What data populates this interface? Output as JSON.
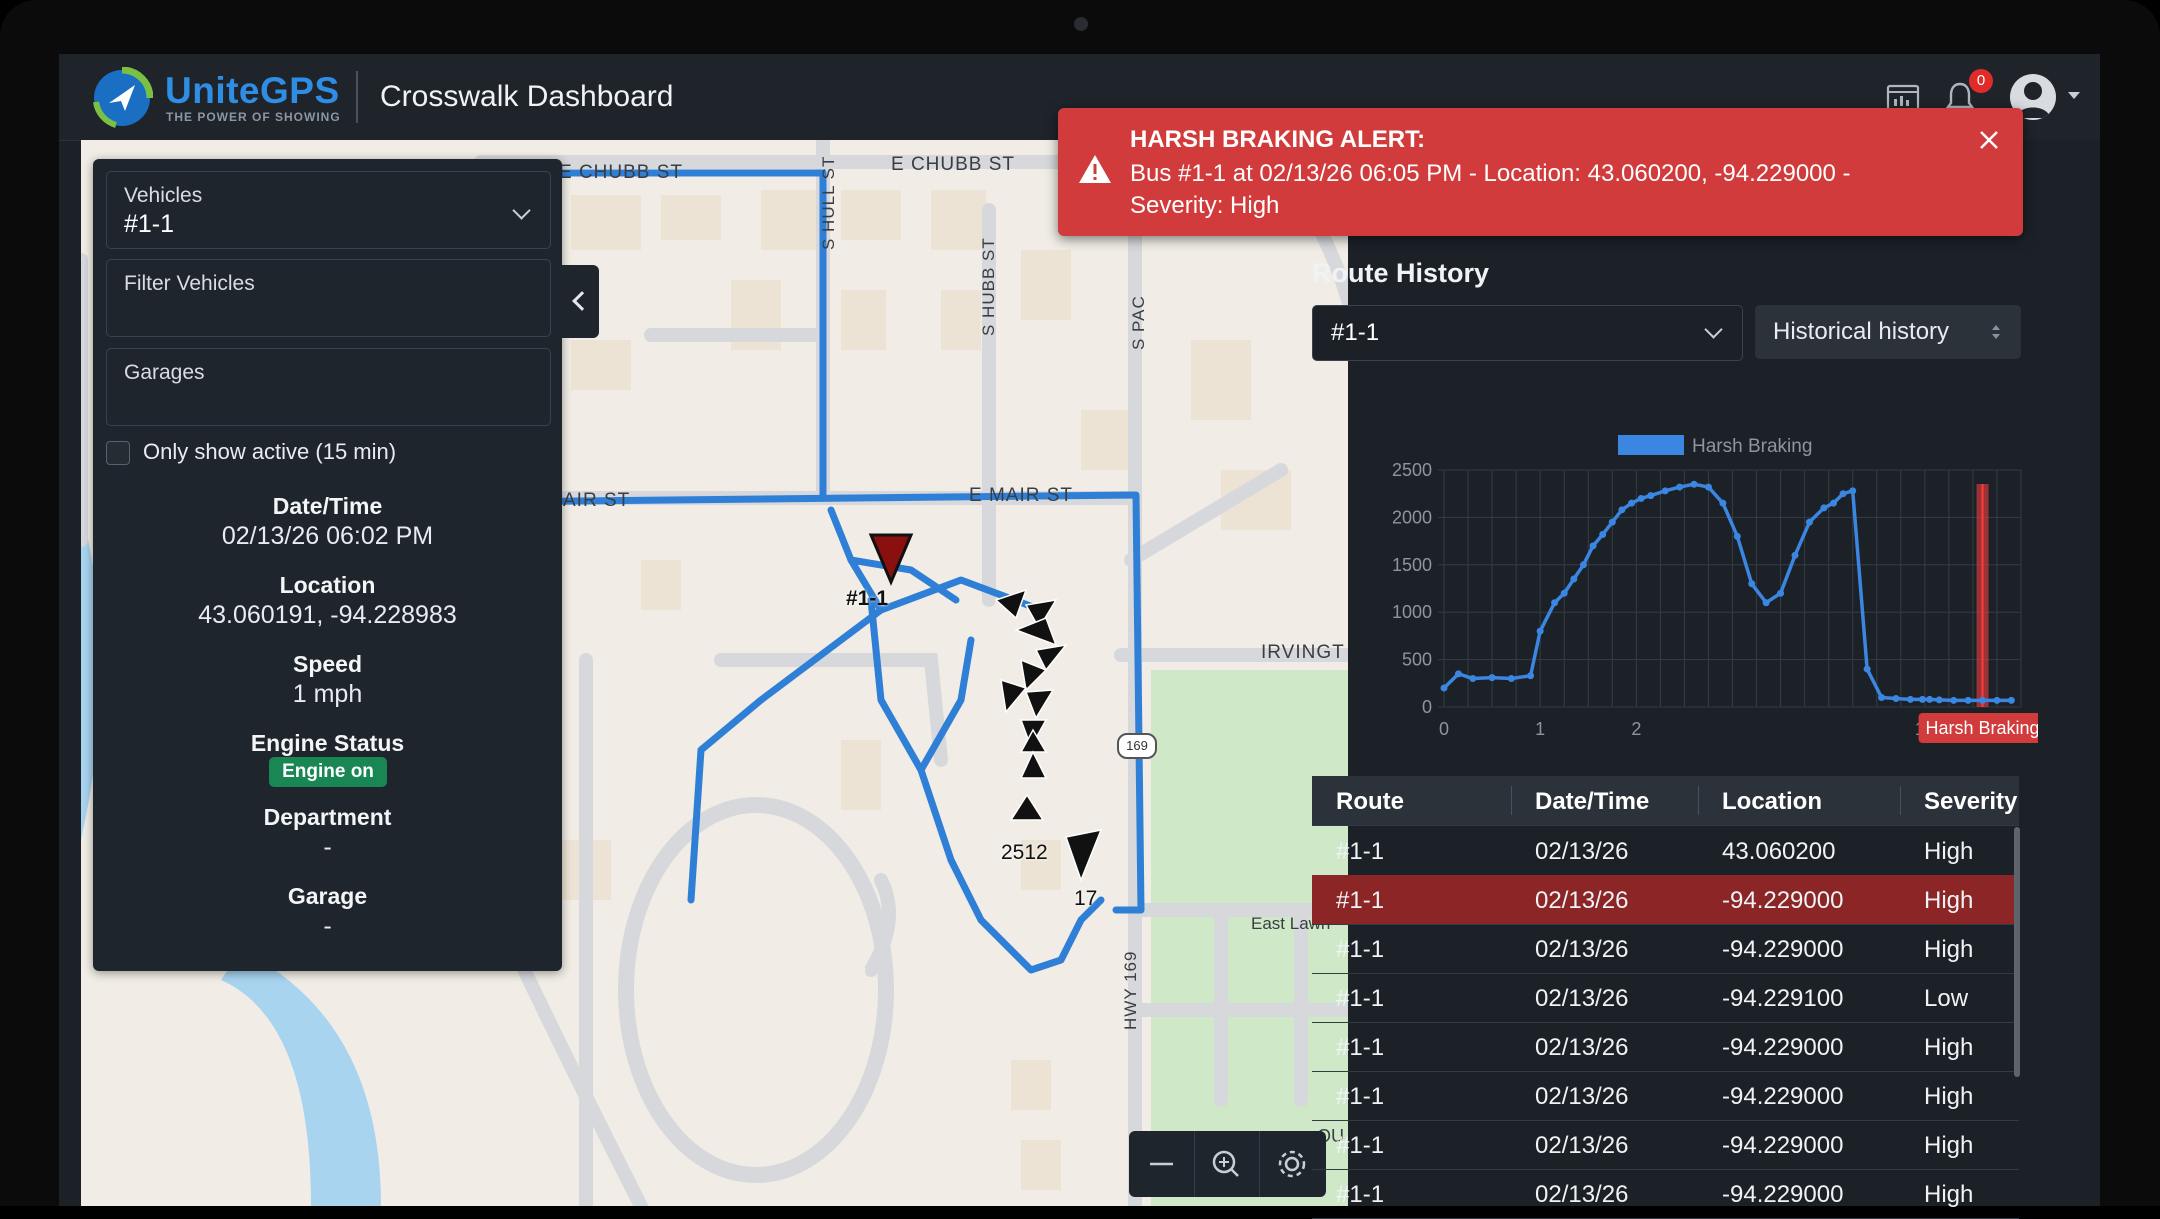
{
  "header": {
    "brand": "UniteGPS",
    "tagline": "THE POWER OF SHOWING",
    "title": "Crosswalk Dashboard",
    "notification_count": "0",
    "icons": [
      "report-icon",
      "bell-icon",
      "user-avatar-icon",
      "caret-down-icon"
    ]
  },
  "left_panel": {
    "vehicles_label": "Vehicles",
    "vehicles_value": "#1-1",
    "filter_label": "Filter Vehicles",
    "garages_label": "Garages",
    "active_checkbox_label": "Only show active (15 min)",
    "datetime_label": "Date/Time",
    "datetime_value": "02/13/26 06:02 PM",
    "location_label": "Location",
    "location_value": "43.060191, -94.228983",
    "speed_label": "Speed",
    "speed_value": "1 mph",
    "engine_label": "Engine Status",
    "engine_value": "Engine on",
    "department_label": "Department",
    "department_value": "-",
    "garage_label": "Garage",
    "garage_value": "-"
  },
  "map": {
    "streets": [
      "E CHUBB ST",
      "E CHUBB ST",
      "S HULL ST",
      "S HUBB ST",
      "S PAC",
      "E MAIR ST",
      "AIR ST",
      "IRVINGT",
      "HWY 169",
      "East Lawn",
      "169",
      "OU"
    ],
    "vehicle_labels": [
      "#1-1",
      "2512",
      "17"
    ],
    "route_color": "#2f7fd6"
  },
  "alert": {
    "title": "HARSH BRAKING ALERT:",
    "message": "Bus #1-1 at 02/13/26 06:05 PM - Location: 43.060200, -94.229000 - Severity: High",
    "color": "#d13b3b"
  },
  "route_history": {
    "title": "Route History",
    "route_select": "#1-1",
    "history_select": "Historical history"
  },
  "chart_data": {
    "type": "line",
    "legend": [
      "Harsh Braking"
    ],
    "legend_position": "top",
    "marker_label": "Harsh Braking",
    "marker_x": 11.2,
    "xticks": [
      "0",
      "1",
      "2",
      "15"
    ],
    "xtick_positions": [
      0,
      2,
      4,
      10
    ],
    "yticks": [
      0,
      500,
      1000,
      1500,
      2000,
      2500
    ],
    "ylim": [
      0,
      2500
    ],
    "xlim": [
      0,
      12
    ],
    "grid": true,
    "series": [
      {
        "name": "Harsh Braking",
        "color": "#3a86e0",
        "x": [
          0,
          0.3,
          0.6,
          1,
          1.4,
          1.8,
          2.0,
          2.3,
          2.5,
          2.7,
          2.9,
          3.1,
          3.3,
          3.5,
          3.7,
          3.9,
          4.1,
          4.3,
          4.6,
          4.9,
          5.2,
          5.5,
          5.8,
          6.1,
          6.4,
          6.7,
          7.0,
          7.3,
          7.6,
          7.9,
          8.1,
          8.3,
          8.5,
          8.8,
          9.1,
          9.4,
          9.7,
          9.95,
          10.1,
          10.3,
          10.6,
          10.9,
          11.2,
          11.5,
          11.8
        ],
        "y": [
          200,
          350,
          300,
          310,
          300,
          330,
          800,
          1100,
          1200,
          1350,
          1500,
          1700,
          1820,
          1950,
          2080,
          2150,
          2200,
          2230,
          2280,
          2320,
          2350,
          2320,
          2150,
          1800,
          1300,
          1100,
          1200,
          1600,
          1950,
          2100,
          2150,
          2250,
          2280,
          400,
          100,
          90,
          80,
          80,
          80,
          75,
          70,
          70,
          70,
          70,
          70
        ]
      }
    ]
  },
  "table": {
    "columns": [
      "Route",
      "Date/Time",
      "Location",
      "Severity"
    ],
    "rows": [
      [
        "#1-1",
        "02/13/26",
        "43.060200",
        "High"
      ],
      [
        "#1-1",
        "02/13/26",
        "-94.229000",
        "High"
      ],
      [
        "#1-1",
        "02/13/26",
        "-94.229000",
        "High"
      ],
      [
        "#1-1",
        "02/13/26",
        "-94.229100",
        "Low"
      ],
      [
        "#1-1",
        "02/13/26",
        "-94.229000",
        "High"
      ],
      [
        "#1-1",
        "02/13/26",
        "-94.229000",
        "High"
      ],
      [
        "#1-1",
        "02/13/26",
        "-94.229000",
        "High"
      ],
      [
        "#1-1",
        "02/13/26",
        "-94.229000",
        "High"
      ]
    ],
    "highlighted_row": 1
  }
}
